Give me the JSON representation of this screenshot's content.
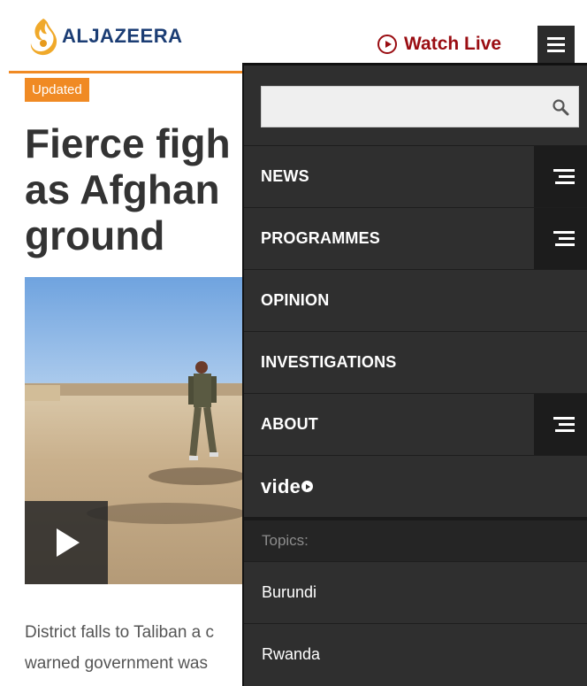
{
  "header": {
    "logo_text": "ALJAZEERA",
    "watch_live": "Watch Live",
    "menu_icon": "hamburger-icon",
    "accent": "#f08a24",
    "brand_color": "#1b3d74",
    "live_color": "#9a0d12"
  },
  "article": {
    "badge": "Updated",
    "headline_lines": [
      "Fierce figh",
      "as Afghan",
      "ground"
    ],
    "summary_lines": [
      "District falls to Taliban a c",
      "warned government was"
    ],
    "play_icon": "play-icon"
  },
  "menu": {
    "search_placeholder": "",
    "search_icon": "search-icon",
    "items": [
      {
        "label": "NEWS",
        "has_submenu": true
      },
      {
        "label": "PROGRAMMES",
        "has_submenu": true
      },
      {
        "label": "OPINION",
        "has_submenu": false
      },
      {
        "label": "INVESTIGATIONS",
        "has_submenu": false
      },
      {
        "label": "ABOUT",
        "has_submenu": true
      }
    ],
    "video_label": "vide",
    "topics_heading": "Topics:",
    "topics": [
      "Burundi",
      "Rwanda"
    ]
  }
}
